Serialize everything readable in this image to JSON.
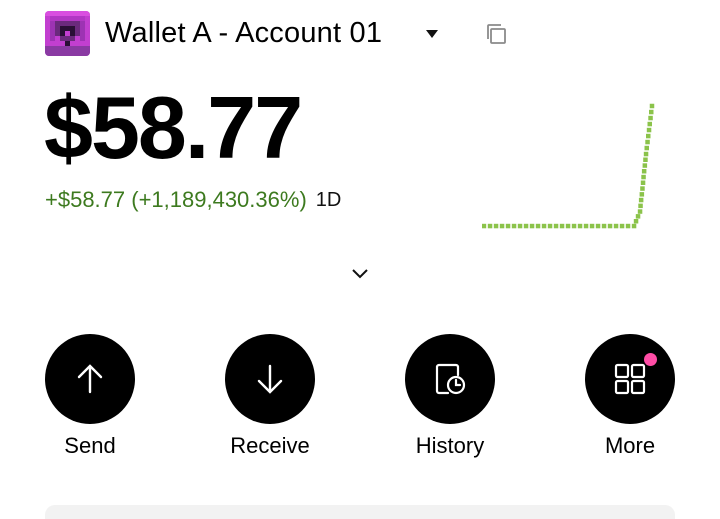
{
  "header": {
    "account_title": "Wallet A - Account 01",
    "avatar_icon": "pixel-avatar-icon",
    "dropdown_icon": "caret-down-icon",
    "copy_icon": "copy-icon"
  },
  "balance": {
    "amount": "$58.77",
    "change": "+$58.77 (+1,189,430.36%)",
    "period": "1D",
    "change_color": "#3d7a1f"
  },
  "sparkline": {
    "color": "#8bc34a",
    "values": [
      0,
      0,
      0,
      0,
      0,
      0,
      0,
      0,
      0,
      0,
      0,
      0,
      0,
      0,
      0,
      0,
      0,
      0,
      0,
      0,
      0,
      0,
      0,
      0,
      0,
      0,
      0.12,
      0.6,
      1.0
    ]
  },
  "expand_icon": "chevron-down-icon",
  "actions": [
    {
      "label": "Send",
      "icon": "arrow-up-icon"
    },
    {
      "label": "Receive",
      "icon": "arrow-down-icon"
    },
    {
      "label": "History",
      "icon": "history-icon"
    },
    {
      "label": "More",
      "icon": "grid-icon",
      "badge_color": "#ff4da6"
    }
  ]
}
